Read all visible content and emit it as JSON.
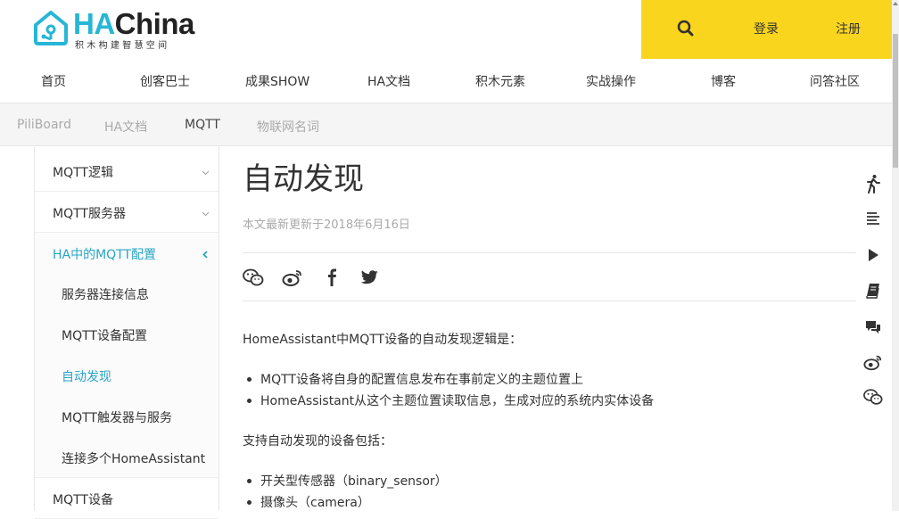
{
  "header": {
    "logo_main_prefix": "HA",
    "logo_main_suffix": "China",
    "logo_sub": "积木构建智慧空间",
    "login": "登录",
    "register": "注册",
    "accent_color": "#fad51d",
    "brand_color": "#27b6d6"
  },
  "nav": {
    "items": [
      "首页",
      "创客巴士",
      "成果SHOW",
      "HA文档",
      "积木元素",
      "实战操作",
      "博客",
      "问答社区"
    ]
  },
  "subnav": {
    "items": [
      "PiliBoard",
      "HA文档",
      "MQTT",
      "物联网名词"
    ],
    "active_index": 2
  },
  "sidebar": {
    "items": [
      {
        "label": "MQTT逻辑",
        "icon": "chevron-down-icon"
      },
      {
        "label": "MQTT服务器",
        "icon": "chevron-down-icon"
      },
      {
        "label": "HA中的MQTT配置",
        "icon": "chevron-left-icon"
      }
    ],
    "sub_items": [
      "服务器连接信息",
      "MQTT设备配置",
      "自动发现",
      "MQTT触发器与服务",
      "连接多个HomeAssistant"
    ],
    "active_sub_index": 2,
    "last_item": "MQTT设备"
  },
  "article": {
    "title": "自动发现",
    "updated": "本文最新更新于2018年6月16日",
    "share_icons": [
      "wechat-icon",
      "weibo-icon",
      "facebook-icon",
      "twitter-icon"
    ],
    "intro": "HomeAssistant中MQTT设备的自动发现逻辑是：",
    "logic_bullets": [
      "MQTT设备将自身的配置信息发布在事前定义的主题位置上",
      "HomeAssistant从这个主题位置读取信息，生成对应的系统内实体设备"
    ],
    "supported_intro": "支持自动发现的设备包括：",
    "device_bullets": [
      "开关型传感器（binary_sensor）",
      "摄像头（camera）"
    ]
  },
  "right_tools": [
    "walk-icon",
    "toc-icon",
    "play-icon",
    "book-icon",
    "comment-icon",
    "weibo-icon",
    "wechat-icon"
  ]
}
